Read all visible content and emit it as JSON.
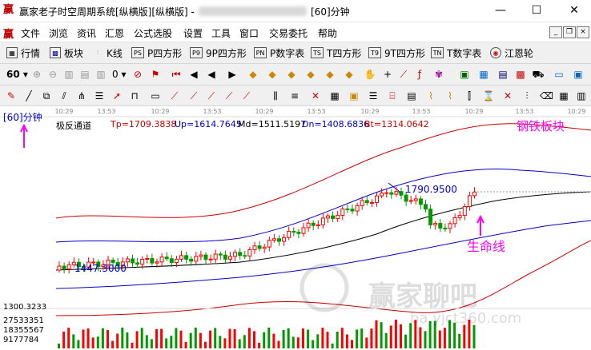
{
  "window": {
    "title": "赢家老子时空周期系统[纵横版][纵横版] -",
    "period_title": "[60]分钟",
    "min": "—",
    "max": "☐",
    "close": "✕"
  },
  "menu": [
    "文件",
    "浏览",
    "资讯",
    "汇恩",
    "公式选股",
    "设置",
    "工具",
    "窗口",
    "交易委托",
    "帮助"
  ],
  "toolbar1": [
    "行情",
    "板块",
    "K线",
    "P四方形",
    "9P四方形",
    "P数字表",
    "T四方形",
    "9T四方形",
    "T数字表",
    "江恩轮"
  ],
  "toolbar1_icons": [
    "PS",
    "P9",
    "PN",
    "TS",
    "T9",
    "TN"
  ],
  "toolbar2": {
    "period_select": "60",
    "stepper": "0"
  },
  "chart": {
    "period_label": "[60]分钟",
    "indicator_name": "极反通道",
    "tp": "Tp=1709.3838",
    "up": "Up=1614.7645",
    "md": "Md=1511.5197",
    "dn": "Dn=1408.6836",
    "bt": "Bt=1314.0642",
    "sector_title": "钢铁板块",
    "high_label": "1790.9500",
    "low_label": "1447.3000",
    "annotation": "生命线",
    "watermark": "赢家聊吧",
    "watermark_url": "ba.yjct360.com",
    "time_ticks": [
      "10:29",
      "13:53",
      "10:29",
      "13:53",
      "10:29",
      "13:53",
      "10:29",
      "13:53",
      "10:29",
      "13:53",
      "10:29",
      "13:53"
    ],
    "price_scale": "1300.3233",
    "vol_ticks": [
      "27533351",
      "18355567",
      "9177784"
    ],
    "colors": {
      "up": "#ff0000",
      "down": "#009900",
      "upper_band": "#cc0000",
      "mid_band": "#0000cc",
      "life": "#000000",
      "pink": "#ff00ff"
    }
  }
}
